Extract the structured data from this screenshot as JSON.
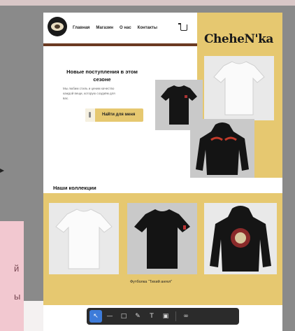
{
  "site": {
    "brand": "CheheN'ka",
    "nav": [
      "Главная",
      "Магазин",
      "О нас",
      "Контакты"
    ]
  },
  "hero": {
    "title": "Новые поступления в этом сезоне",
    "description": "Мы любим стиль и ценим качество каждой вещи, которую создаём для вас.",
    "search_label": "Найти для меня"
  },
  "collection": {
    "title": "Наши коллекции",
    "caption": "Футболка “Тихий ангел”"
  },
  "desktop": {
    "side_note_lines": [
      "й",
      "ы"
    ]
  },
  "toolbar": {
    "tools": [
      "pointer-tool",
      "line-tool",
      "rectangle-tool",
      "pen-tool",
      "text-tool",
      "image-tool",
      "more-tool"
    ]
  }
}
